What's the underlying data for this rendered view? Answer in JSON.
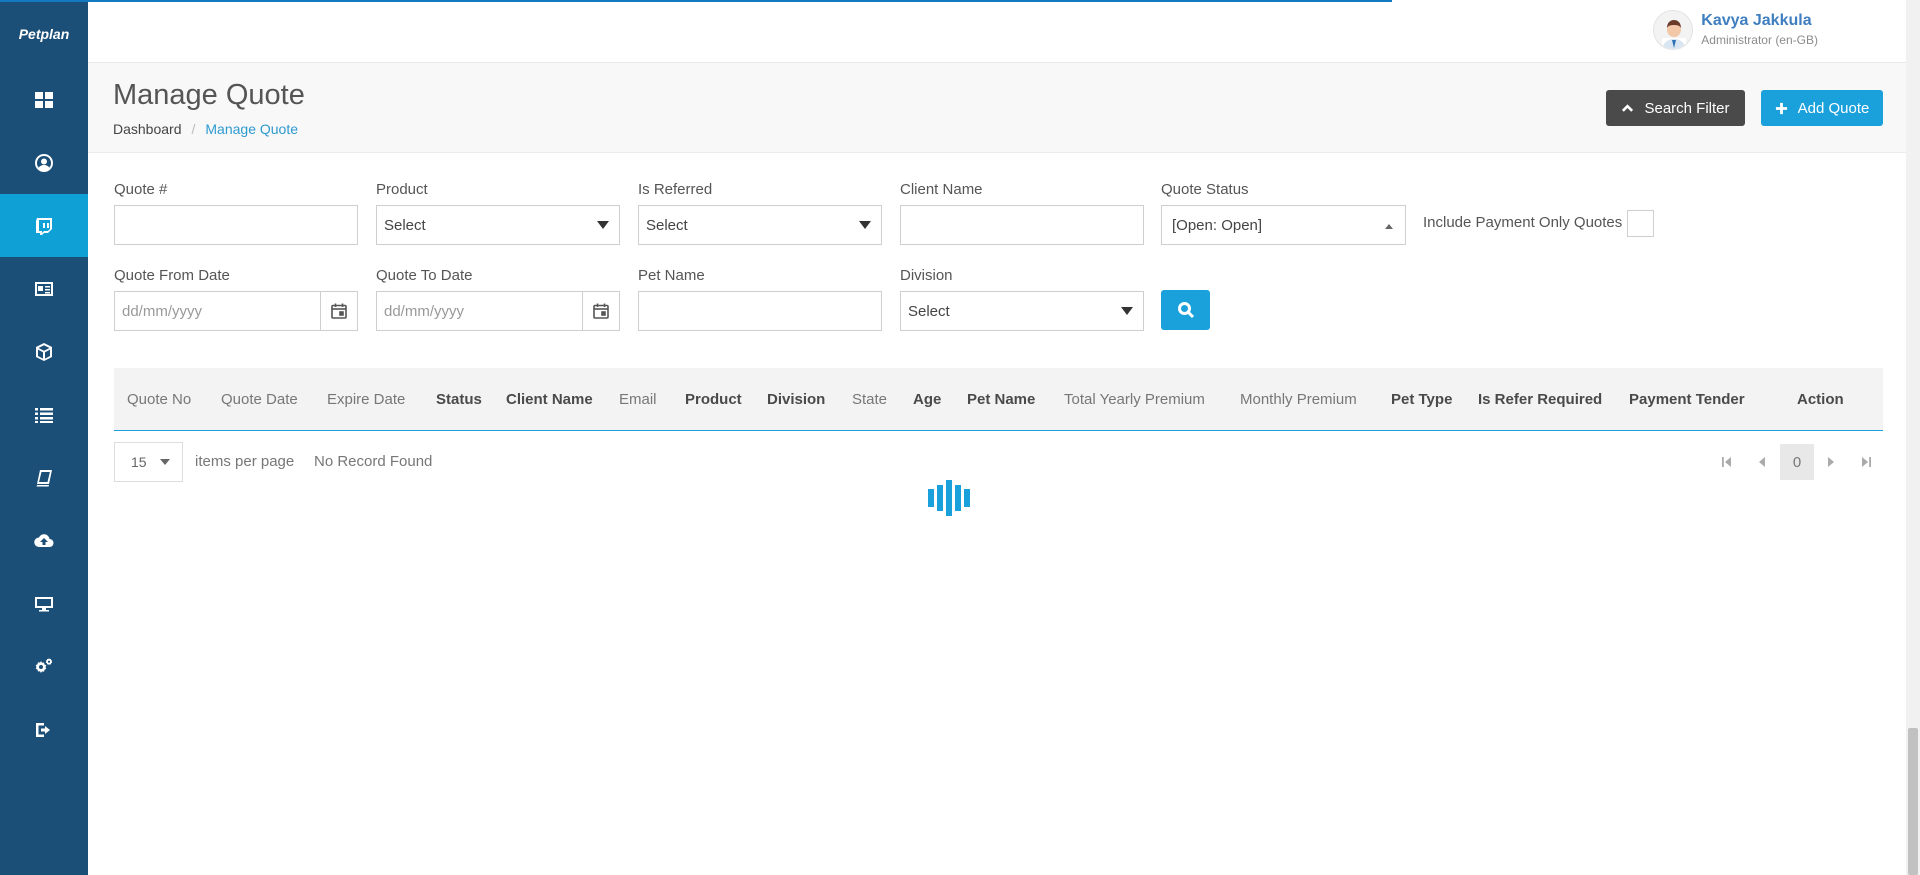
{
  "brand": {
    "name": "Petplan"
  },
  "sidebar": {
    "items": [
      {
        "icon": "dashboard-icon",
        "active": false
      },
      {
        "icon": "user-circle-icon",
        "active": false
      },
      {
        "icon": "quote-chat-icon",
        "active": true
      },
      {
        "icon": "id-card-icon",
        "active": false
      },
      {
        "icon": "cube-icon",
        "active": false
      },
      {
        "icon": "list-icon",
        "active": false
      },
      {
        "icon": "book-icon",
        "active": false
      },
      {
        "icon": "cloud-upload-icon",
        "active": false
      },
      {
        "icon": "desktop-icon",
        "active": false
      },
      {
        "icon": "gears-icon",
        "active": false
      },
      {
        "icon": "sign-out-icon",
        "active": false
      }
    ]
  },
  "user": {
    "name": "Kavya Jakkula",
    "role": "Administrator",
    "locale": "(en-GB)"
  },
  "page": {
    "title": "Manage Quote",
    "breadcrumb": {
      "home": "Dashboard",
      "separator": "/",
      "current": "Manage Quote"
    },
    "search_filter_label": "Search Filter",
    "add_quote_label": "Add Quote"
  },
  "filters": {
    "quote_no": {
      "label": "Quote #",
      "value": ""
    },
    "product": {
      "label": "Product",
      "value": "Select"
    },
    "is_referred": {
      "label": "Is Referred",
      "value": "Select"
    },
    "client_name": {
      "label": "Client Name",
      "value": ""
    },
    "quote_status": {
      "label": "Quote Status",
      "value": "[Open: Open]"
    },
    "include_payment_only": {
      "label": "Include Payment Only Quotes",
      "checked": false
    },
    "quote_from_date": {
      "label": "Quote From Date",
      "placeholder": "dd/mm/yyyy"
    },
    "quote_to_date": {
      "label": "Quote To Date",
      "placeholder": "dd/mm/yyyy"
    },
    "pet_name": {
      "label": "Pet Name",
      "value": ""
    },
    "division": {
      "label": "Division",
      "value": "Select"
    }
  },
  "grid": {
    "columns": [
      "Quote No",
      "Quote Date",
      "Expire Date",
      "Status",
      "Client Name",
      "Email",
      "Product",
      "Division",
      "State",
      "Age",
      "Pet Name",
      "Total Yearly Premium",
      "Monthly Premium",
      "Pet Type",
      "Is Refer Required",
      "Payment Tender",
      "Action"
    ],
    "rows": []
  },
  "pager": {
    "page_size": "15",
    "items_per_page_label": "items per page",
    "status": "No Record Found",
    "current_page": "0"
  },
  "colors": {
    "sidebar": "#1b4f78",
    "accent": "#1aa1dc",
    "filter_button": "#4a4a4a"
  }
}
